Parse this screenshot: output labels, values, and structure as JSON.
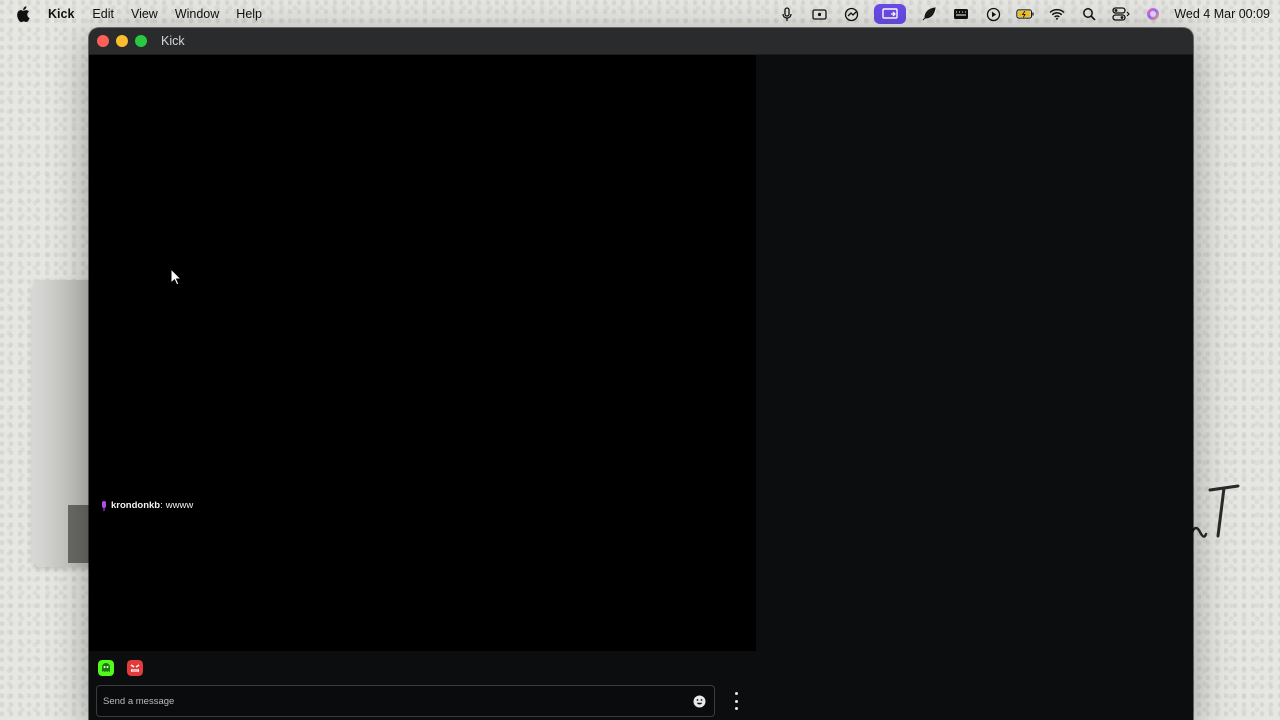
{
  "menubar": {
    "app_name": "Kick",
    "items": [
      "Edit",
      "View",
      "Window",
      "Help"
    ],
    "clock": "Wed 4 Mar  00:09",
    "status_icons": [
      "microphone-icon",
      "screen-record-icon",
      "share-icon",
      "screen-mirror-icon",
      "feather-icon",
      "keyboard-icon",
      "play-icon",
      "battery-icon",
      "wifi-icon",
      "spotlight-icon",
      "control-center-icon",
      "siri-icon"
    ],
    "accent": "#6a4be8"
  },
  "window": {
    "title": "Kick"
  },
  "chat": {
    "messages": [
      {
        "user": "krondonkb",
        "separator": ":",
        "text": "wwww",
        "badge_color": "#b04cf0"
      }
    ]
  },
  "composer": {
    "placeholder": "Send a message",
    "emote_icons": [
      "green-ghost-emote-icon",
      "red-face-emote-icon"
    ]
  }
}
